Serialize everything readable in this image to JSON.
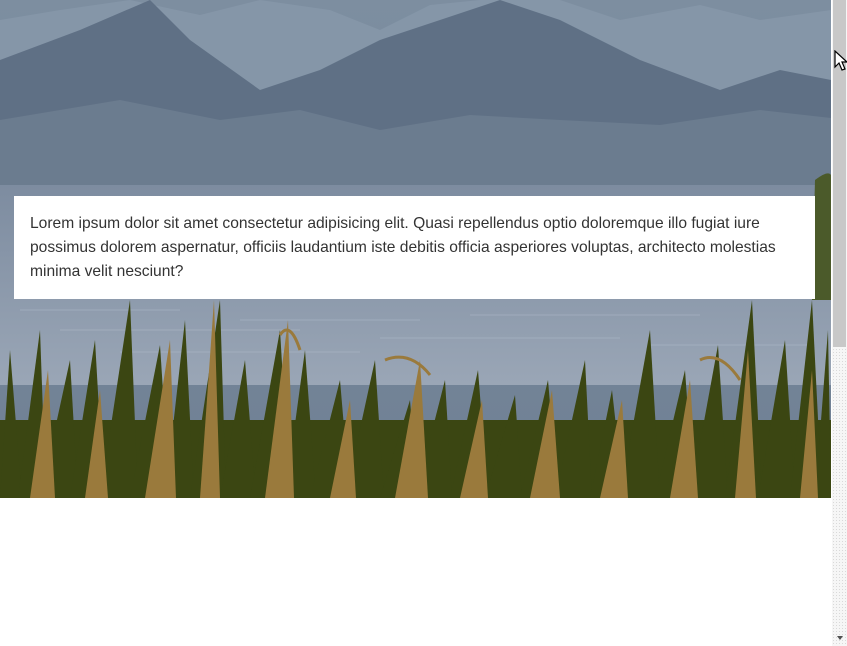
{
  "content": {
    "paragraph": "Lorem ipsum dolor sit amet consectetur adipisicing elit. Quasi repellendus optio doloremque illo fugiat iure possimus dolorem aspernatur, officiis laudantium iste debitis officia asperiores voluptas, architecto molestias minima velit nesciunt?"
  },
  "colors": {
    "card_background": "#ffffff",
    "text": "#333333",
    "sky": "#6d7f92",
    "water": "#8f9eb0",
    "grass_dark": "#3b4612",
    "grass_light": "#9a7a3c"
  }
}
